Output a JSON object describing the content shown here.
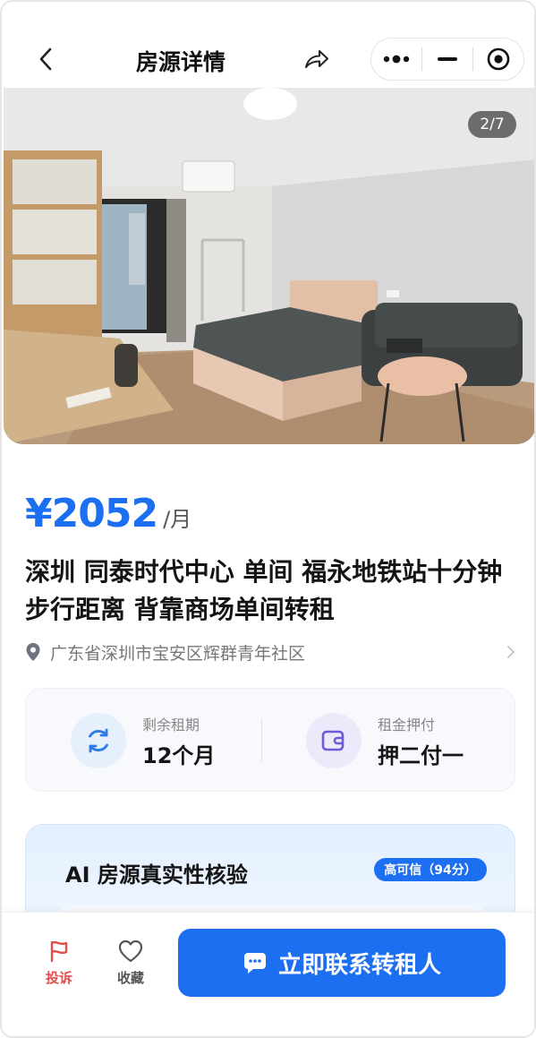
{
  "nav": {
    "title": "房源详情",
    "back_icon": "chevron-left-icon",
    "share_icon": "share-icon",
    "capsule": {
      "more_icon": "more-dots-icon",
      "minimize_icon": "minimize-icon",
      "close_icon": "target-close-icon"
    }
  },
  "gallery": {
    "counter": "2/7"
  },
  "listing": {
    "price": "¥2052",
    "price_unit": "/月",
    "title": "深圳 同泰时代中心 单间 福永地铁站十分钟步行距离 背靠商场单间转租",
    "address": "广东省深圳市宝安区辉群青年社区"
  },
  "info": {
    "remaining": {
      "label": "剩余租期",
      "value": "12个月",
      "icon": "refresh-icon",
      "icon_bg": "#e6effc",
      "icon_color": "#2c7be5"
    },
    "deposit": {
      "label": "租金押付",
      "value": "押二付一",
      "icon": "wallet-icon",
      "icon_bg": "#ece9fb",
      "icon_color": "#6b5bd6"
    }
  },
  "ai_check": {
    "title": "AI 房源真实性核验",
    "badge": "高可信（94分）"
  },
  "bottom": {
    "report": {
      "label": "投诉",
      "icon": "flag-icon",
      "color": "#e34d4d"
    },
    "favorite": {
      "label": "收藏",
      "icon": "heart-icon",
      "color": "#555555"
    },
    "contact": {
      "label": "立即联系转租人",
      "icon": "chat-bubble-icon"
    }
  },
  "colors": {
    "accent": "#1d6ff2"
  }
}
